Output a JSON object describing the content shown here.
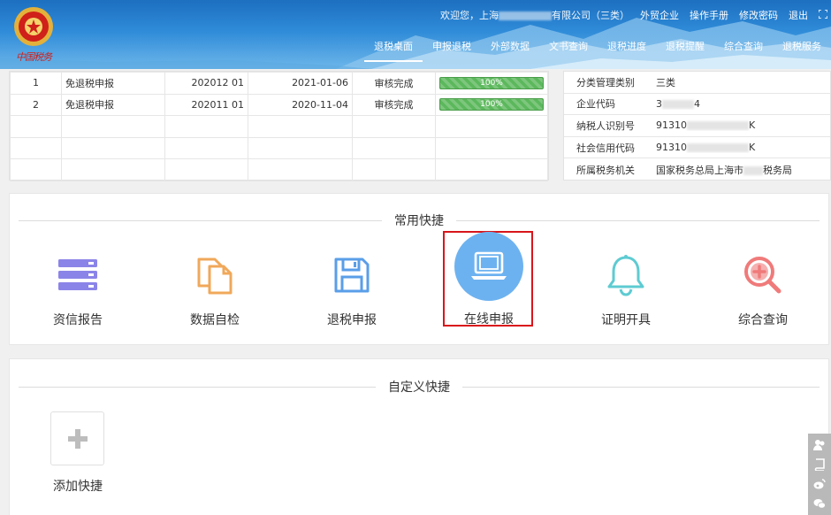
{
  "header": {
    "welcome": "欢迎您，上海",
    "welcome_suffix": "有限公司（三类）",
    "links": [
      "外贸企业",
      "操作手册",
      "修改密码",
      "退出"
    ],
    "emblem_text": "中国税务",
    "nav": [
      {
        "label": "退税桌面",
        "active": true
      },
      {
        "label": "申报退税",
        "active": false
      },
      {
        "label": "外部数据",
        "active": false
      },
      {
        "label": "文书查询",
        "active": false
      },
      {
        "label": "退税进度",
        "active": false
      },
      {
        "label": "退税提醒",
        "active": false
      },
      {
        "label": "综合查询",
        "active": false
      },
      {
        "label": "退税服务",
        "active": false
      }
    ]
  },
  "table": {
    "rows": [
      {
        "no": "1",
        "type": "免退税申报",
        "period": "202012 01",
        "date": "2021-01-06",
        "status": "审核完成",
        "progress": "100%"
      },
      {
        "no": "2",
        "type": "免退税申报",
        "period": "202011 01",
        "date": "2020-11-04",
        "status": "审核完成",
        "progress": "100%"
      }
    ],
    "empty_rows": 3
  },
  "info": {
    "rows": [
      {
        "key": "分类管理类别",
        "value": "三类",
        "tail": ""
      },
      {
        "key": "企业代码",
        "value": "3",
        "tail": "4"
      },
      {
        "key": "纳税人识别号",
        "value": "91310",
        "tail": "K"
      },
      {
        "key": "社会信用代码",
        "value": "91310",
        "tail": "K"
      },
      {
        "key": "所属税务机关",
        "value": "国家税务总局上海市",
        "tail": "税务局"
      }
    ]
  },
  "common": {
    "title": "常用快捷",
    "items": [
      {
        "label": "资信报告",
        "icon": "credit-report-icon",
        "color": "#8b84e8"
      },
      {
        "label": "数据自检",
        "icon": "data-check-icon",
        "color": "#f0a85a"
      },
      {
        "label": "退税申报",
        "icon": "floppy-disk-icon",
        "color": "#5a9ee8"
      },
      {
        "label": "在线申报",
        "icon": "laptop-icon",
        "color": "#6db2f0"
      },
      {
        "label": "证明开具",
        "icon": "bell-icon",
        "color": "#5ecbd2"
      },
      {
        "label": "综合查询",
        "icon": "zoom-in-icon",
        "color": "#f07a7a"
      }
    ]
  },
  "custom": {
    "title": "自定义快捷",
    "add_label": "添加快捷"
  }
}
